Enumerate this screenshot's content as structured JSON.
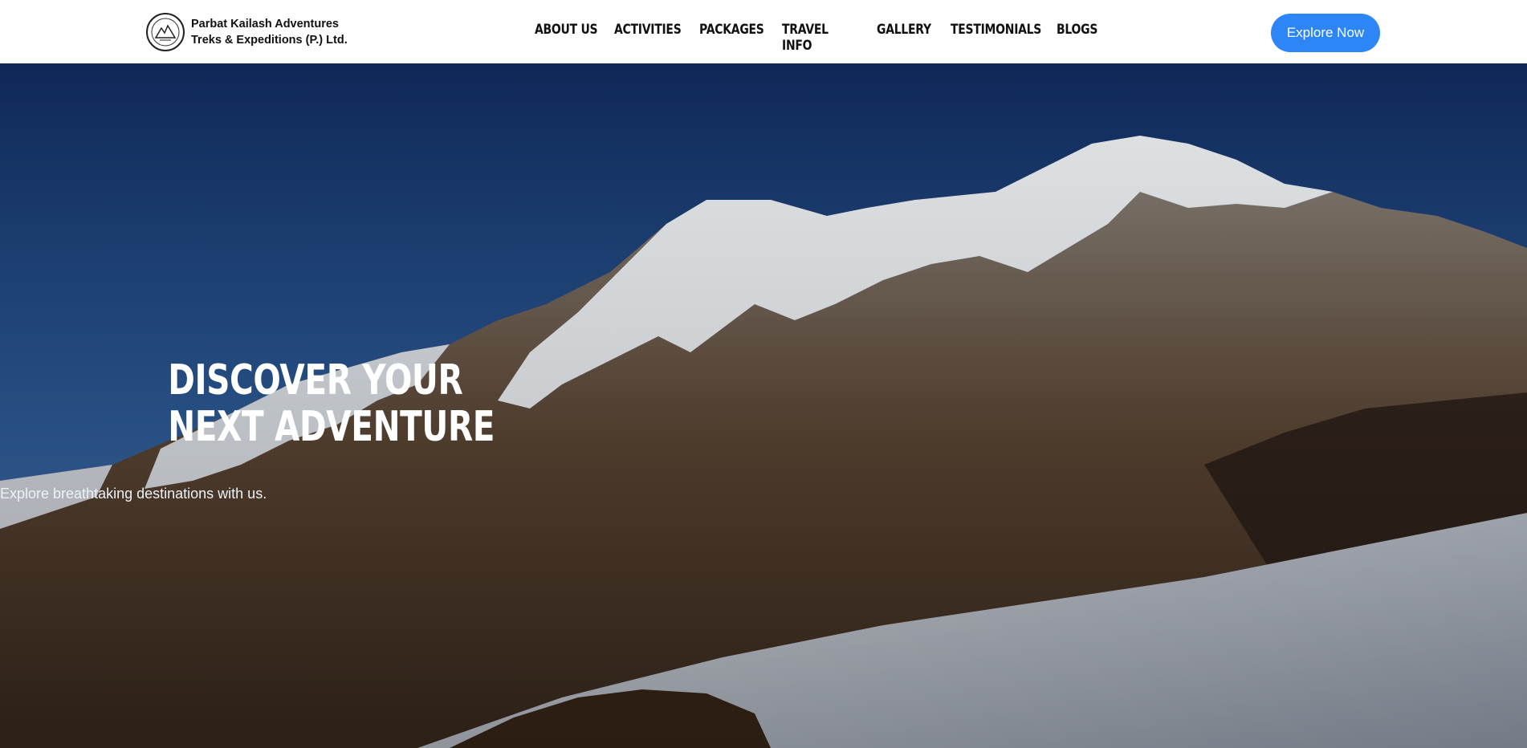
{
  "brand": {
    "line1": "Parbat Kailash Adventures",
    "line2": "Treks & Expeditions (P.) Ltd."
  },
  "nav": {
    "items": [
      {
        "label": "ABOUT US"
      },
      {
        "label": "ACTIVITIES"
      },
      {
        "label": "PACKAGES"
      },
      {
        "label": "TRAVEL INFO"
      },
      {
        "label": "GALLERY"
      },
      {
        "label": "TESTIMONIALS"
      },
      {
        "label": "BLOGS"
      }
    ],
    "cta_label": "Explore Now"
  },
  "hero": {
    "headline_line1": "DISCOVER YOUR",
    "headline_line2": "NEXT ADVENTURE",
    "subtitle": "Explore breathtaking destinations with us."
  },
  "colors": {
    "accent": "#2e86f6",
    "sky_top": "#0f2a5c",
    "sky_bottom": "#3f6faa"
  }
}
